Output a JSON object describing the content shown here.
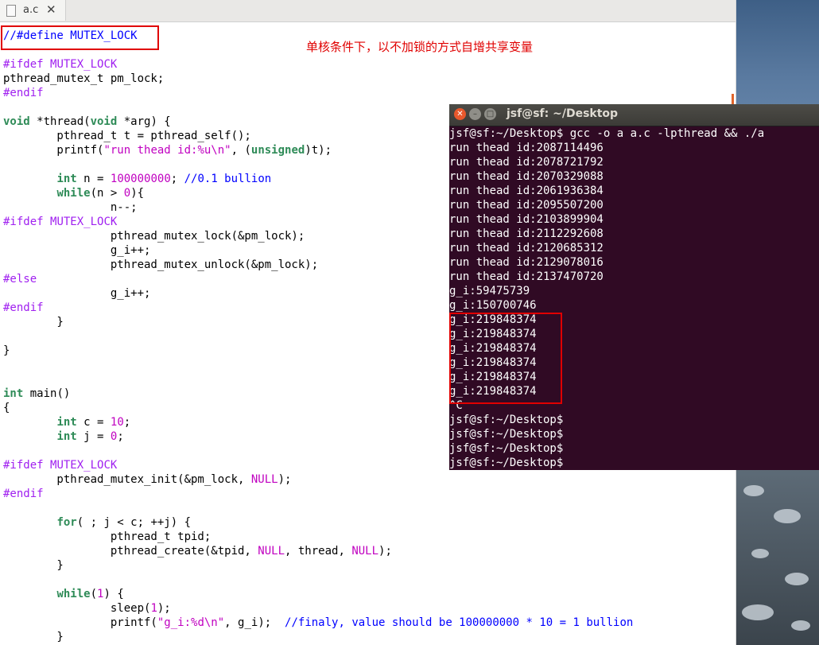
{
  "editor": {
    "tab_name": "a.c",
    "tab_close": "✕",
    "lines": [
      [
        [
          "//#define MUTEX_LOCK",
          "cm"
        ]
      ],
      [],
      [
        [
          "#ifdef ",
          "pp"
        ],
        [
          "MUTEX_LOCK",
          "pp"
        ]
      ],
      [
        [
          "pthread_mutex_t pm_lock;",
          ""
        ]
      ],
      [
        [
          "#endif",
          "pp"
        ]
      ],
      [],
      [
        [
          "void",
          "kw"
        ],
        [
          " *thread(",
          ""
        ],
        [
          "void",
          "kw"
        ],
        [
          " *arg) {",
          ""
        ]
      ],
      [
        [
          "        pthread_t t = pthread_self();",
          ""
        ]
      ],
      [
        [
          "        printf(",
          ""
        ],
        [
          "\"run thead id:%u\\n\"",
          "str"
        ],
        [
          ", (",
          ""
        ],
        [
          "unsigned",
          "kw"
        ],
        [
          ")t);",
          ""
        ]
      ],
      [],
      [
        [
          "        ",
          ""
        ],
        [
          "int",
          "kw"
        ],
        [
          " n = ",
          ""
        ],
        [
          "100000000",
          "num"
        ],
        [
          "; ",
          ""
        ],
        [
          "//0.1 bullion",
          "cm"
        ]
      ],
      [
        [
          "        ",
          ""
        ],
        [
          "while",
          "kw"
        ],
        [
          "(n > ",
          ""
        ],
        [
          "0",
          "num"
        ],
        [
          "){",
          ""
        ]
      ],
      [
        [
          "                n--;",
          ""
        ]
      ],
      [
        [
          "#ifdef ",
          "pp"
        ],
        [
          "MUTEX_LOCK",
          "pp"
        ]
      ],
      [
        [
          "                pthread_mutex_lock(&pm_lock);",
          ""
        ]
      ],
      [
        [
          "                g_i++;",
          ""
        ]
      ],
      [
        [
          "                pthread_mutex_unlock(&pm_lock);",
          ""
        ]
      ],
      [
        [
          "#else",
          "pp"
        ]
      ],
      [
        [
          "                g_i++;",
          ""
        ]
      ],
      [
        [
          "#endif",
          "pp"
        ]
      ],
      [
        [
          "        }",
          ""
        ]
      ],
      [],
      [
        [
          "}",
          ""
        ]
      ],
      [],
      [],
      [
        [
          "int",
          "kw"
        ],
        [
          " main()",
          ""
        ]
      ],
      [
        [
          "{",
          ""
        ]
      ],
      [
        [
          "        ",
          ""
        ],
        [
          "int",
          "kw"
        ],
        [
          " c = ",
          ""
        ],
        [
          "10",
          "num"
        ],
        [
          ";",
          ""
        ]
      ],
      [
        [
          "        ",
          ""
        ],
        [
          "int",
          "kw"
        ],
        [
          " j = ",
          ""
        ],
        [
          "0",
          "num"
        ],
        [
          ";",
          ""
        ]
      ],
      [],
      [
        [
          "#ifdef ",
          "pp"
        ],
        [
          "MUTEX_LOCK",
          "pp"
        ]
      ],
      [
        [
          "        pthread_mutex_init(&pm_lock, ",
          ""
        ],
        [
          "NULL",
          "num"
        ],
        [
          ");",
          ""
        ]
      ],
      [
        [
          "#endif",
          "pp"
        ]
      ],
      [],
      [
        [
          "        ",
          ""
        ],
        [
          "for",
          "kw"
        ],
        [
          "( ; j < c; ++j) {",
          ""
        ]
      ],
      [
        [
          "                pthread_t tpid;",
          ""
        ]
      ],
      [
        [
          "                pthread_create(&tpid, ",
          ""
        ],
        [
          "NULL",
          "num"
        ],
        [
          ", thread, ",
          ""
        ],
        [
          "NULL",
          "num"
        ],
        [
          ");",
          ""
        ]
      ],
      [
        [
          "        }",
          ""
        ]
      ],
      [],
      [
        [
          "        ",
          ""
        ],
        [
          "while",
          "kw"
        ],
        [
          "(",
          ""
        ],
        [
          "1",
          "num"
        ],
        [
          ") {",
          ""
        ]
      ],
      [
        [
          "                sleep(",
          ""
        ],
        [
          "1",
          "num"
        ],
        [
          ");",
          ""
        ]
      ],
      [
        [
          "                printf(",
          ""
        ],
        [
          "\"g_i:%d\\n\"",
          "str"
        ],
        [
          ", g_i);  ",
          ""
        ],
        [
          "//finaly, value should be 100000000 * 10 = 1 bullion",
          "cm"
        ]
      ],
      [
        [
          "        }",
          ""
        ]
      ]
    ]
  },
  "annotation": "单核条件下，以不加锁的方式自增共享变量",
  "terminal": {
    "title": "jsf@sf: ~/Desktop",
    "buttons": {
      "close": "✕",
      "minimize": "–",
      "maximize": "□"
    },
    "lines": [
      "jsf@sf:~/Desktop$ gcc -o a a.c -lpthread && ./a",
      "run thead id:2087114496",
      "run thead id:2078721792",
      "run thead id:2070329088",
      "run thead id:2061936384",
      "run thead id:2095507200",
      "run thead id:2103899904",
      "run thead id:2112292608",
      "run thead id:2120685312",
      "run thead id:2129078016",
      "run thead id:2137470720",
      "g_i:59475739",
      "g_i:150700746",
      "g_i:219848374",
      "g_i:219848374",
      "g_i:219848374",
      "g_i:219848374",
      "g_i:219848374",
      "g_i:219848374",
      "^C",
      "jsf@sf:~/Desktop$",
      "jsf@sf:~/Desktop$",
      "jsf@sf:~/Desktop$",
      "jsf@sf:~/Desktop$"
    ]
  },
  "colors": {
    "keyword": "#2e8b57",
    "preprocessor": "#a020f0",
    "number": "#c000c0",
    "comment": "#0000ff",
    "highlight_box": "#e00000",
    "terminal_bg": "#300a24"
  }
}
